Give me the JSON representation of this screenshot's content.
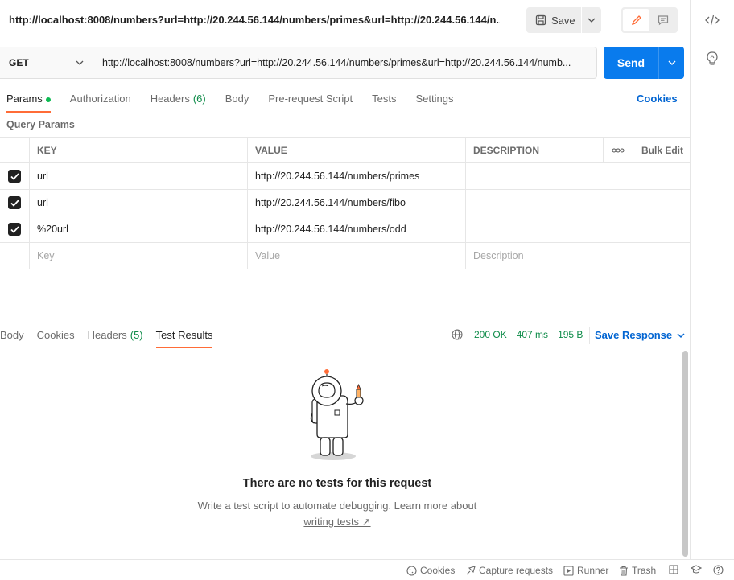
{
  "header": {
    "title": "http://localhost:8008/numbers?url=http://20.244.56.144/numbers/primes&url=http://20.244.56.144/n...",
    "save_label": "Save"
  },
  "request": {
    "method": "GET",
    "url": "http://localhost:8008/numbers?url=http://20.244.56.144/numbers/primes&url=http://20.244.56.144/numb...",
    "send_label": "Send"
  },
  "tabs": [
    {
      "label": "Params"
    },
    {
      "label": "Authorization"
    },
    {
      "label": "Headers",
      "count": "(6)"
    },
    {
      "label": "Body"
    },
    {
      "label": "Pre-request Script"
    },
    {
      "label": "Tests"
    },
    {
      "label": "Settings"
    }
  ],
  "cookies_link": "Cookies",
  "query_params_label": "Query Params",
  "table": {
    "headers": {
      "key": "KEY",
      "value": "VALUE",
      "description": "DESCRIPTION",
      "bulk_edit": "Bulk Edit"
    },
    "rows": [
      {
        "key": "url",
        "value": "http://20.244.56.144/numbers/primes",
        "checked": true
      },
      {
        "key": "url",
        "value": "http://20.244.56.144/numbers/fibo",
        "checked": true
      },
      {
        "key": "%20url",
        "value": "http://20.244.56.144/numbers/odd",
        "checked": true
      }
    ],
    "placeholders": {
      "key": "Key",
      "value": "Value",
      "description": "Description"
    }
  },
  "response": {
    "tabs": [
      {
        "label": "Body"
      },
      {
        "label": "Cookies"
      },
      {
        "label": "Headers",
        "count": "(5)"
      },
      {
        "label": "Test Results"
      }
    ],
    "status": "200 OK",
    "time": "407 ms",
    "size": "195 B",
    "save_label": "Save Response"
  },
  "empty_state": {
    "title": "There are no tests for this request",
    "subtitle": "Write a test script to automate debugging. Learn more about",
    "link": "writing tests ↗"
  },
  "statusbar": {
    "cookies": "Cookies",
    "capture": "Capture requests",
    "runner": "Runner",
    "trash": "Trash"
  },
  "colors": {
    "accent": "#ff6c37",
    "primary": "#097bed",
    "success": "#0f8c4a",
    "link": "#0265d2"
  }
}
